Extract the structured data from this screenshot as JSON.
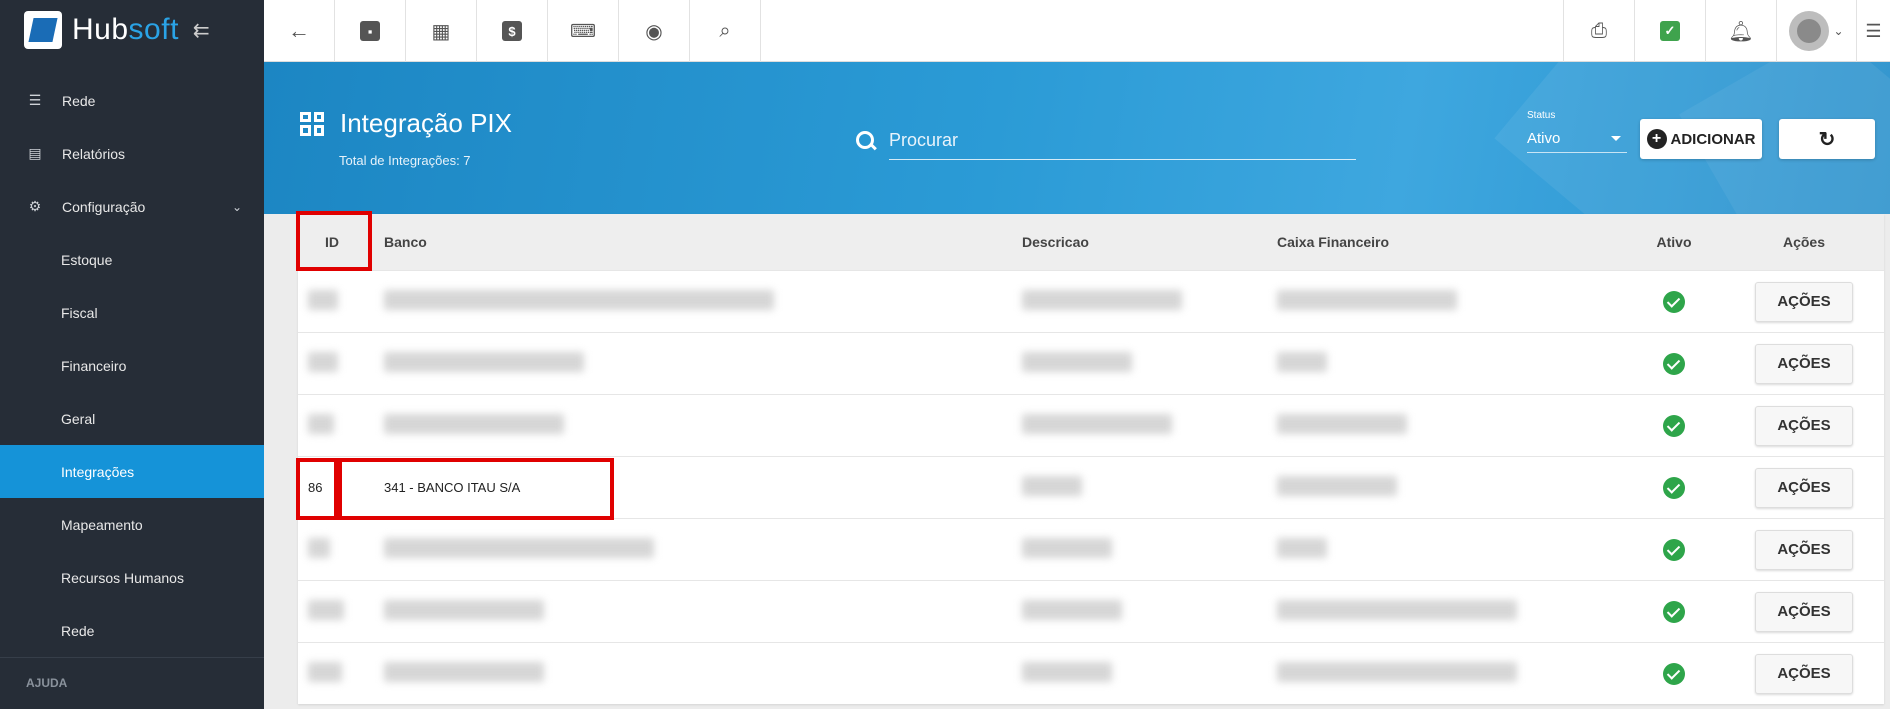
{
  "brand": {
    "name_part1": "Hub",
    "name_part2": "soft"
  },
  "sidebar": {
    "items": [
      {
        "label": "Rede",
        "icon": "server-icon"
      },
      {
        "label": "Relatórios",
        "icon": "document-icon"
      },
      {
        "label": "Configuração",
        "icon": "gear-icon"
      },
      {
        "label": "Estoque"
      },
      {
        "label": "Fiscal"
      },
      {
        "label": "Financeiro"
      },
      {
        "label": "Geral"
      },
      {
        "label": "Integrações"
      },
      {
        "label": "Mapeamento"
      },
      {
        "label": "Recursos Humanos"
      },
      {
        "label": "Rede"
      }
    ],
    "section": "AJUDA"
  },
  "header": {
    "title": "Integração PIX",
    "subtitle": "Total de Integrações: 7",
    "search_placeholder": "Procurar",
    "status_label": "Status",
    "status_value": "Ativo",
    "add_label": "ADICIONAR"
  },
  "table": {
    "columns": [
      "ID",
      "Banco",
      "Descricao",
      "Caixa Financeiro",
      "Ativo",
      "Ações"
    ],
    "action_label": "AÇÕES",
    "visible_row": {
      "id": "86",
      "banco": "341 - BANCO ITAU S/A"
    }
  },
  "colors": {
    "accent": "#1593d8",
    "sidebar_bg": "#262d37",
    "highlight": "#e00000",
    "ok_green": "#2ea54a"
  }
}
